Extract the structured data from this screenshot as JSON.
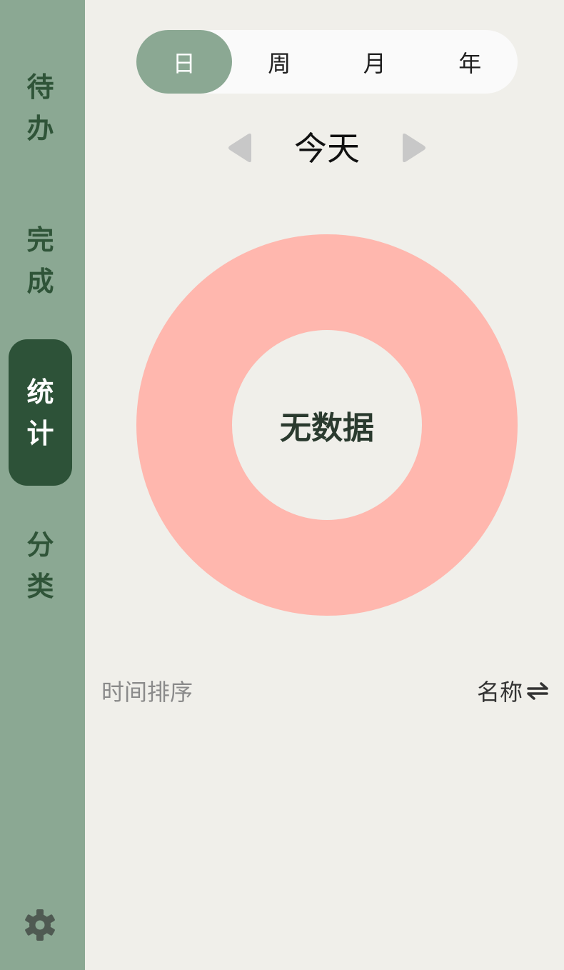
{
  "sidebar": {
    "items": [
      {
        "label": "待办",
        "active": false
      },
      {
        "label": "完成",
        "active": false
      },
      {
        "label": "统计",
        "active": true
      },
      {
        "label": "分类",
        "active": false
      }
    ],
    "settings_icon": "gear-icon"
  },
  "period_tabs": [
    {
      "label": "日",
      "active": true
    },
    {
      "label": "周",
      "active": false
    },
    {
      "label": "月",
      "active": false
    },
    {
      "label": "年",
      "active": false
    }
  ],
  "date_nav": {
    "label": "今天",
    "prev_icon": "triangle-left-icon",
    "next_icon": "triangle-right-icon"
  },
  "chart": {
    "empty_label": "无数据",
    "ring_color": "#ffb7ae"
  },
  "sort": {
    "label": "时间排序",
    "field": "名称",
    "icon": "swap-icon"
  },
  "colors": {
    "sidebar_bg": "#8ba893",
    "active_nav": "#2d5238",
    "page_bg": "#f0efea"
  }
}
